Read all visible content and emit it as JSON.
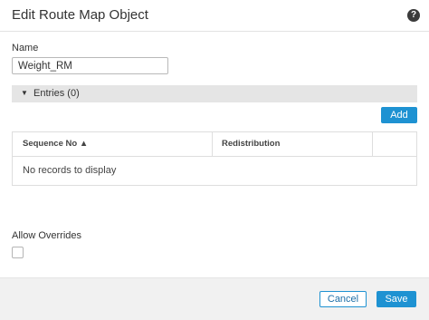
{
  "dialog": {
    "title": "Edit Route Map Object",
    "help_icon": "help-icon",
    "help_glyph": "?"
  },
  "form": {
    "name_label": "Name",
    "name_value": "Weight_RM",
    "allow_overrides_label": "Allow Overrides",
    "allow_overrides_checked": false
  },
  "entries": {
    "caret_icon": "caret-down-icon",
    "caret_glyph": "▼",
    "label": "Entries (0)",
    "add_label": "Add",
    "table": {
      "columns": [
        "Sequence No ▲",
        "Redistribution"
      ],
      "empty_text": "No records to display"
    }
  },
  "footer": {
    "cancel_label": "Cancel",
    "save_label": "Save"
  },
  "colors": {
    "primary": "#1e92d2",
    "section_bar": "#e5e5e5",
    "footer_bg": "#f1f1f1"
  }
}
